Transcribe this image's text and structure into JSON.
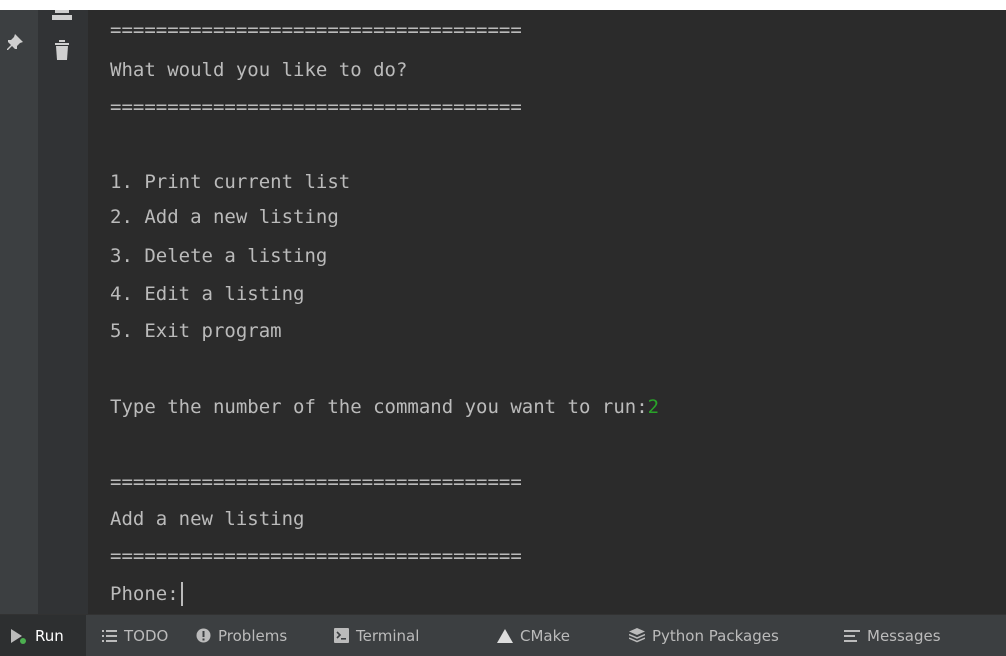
{
  "console": {
    "lines": [
      "====================================",
      "What would you like to do?",
      "====================================",
      "",
      "1. Print current list",
      "2. Add a new listing",
      "3. Delete a listing",
      "4. Edit a listing",
      "5. Exit program",
      "",
      "Type the number of the command you want to run:",
      "",
      "====================================",
      "Add a new listing",
      "===================================="
    ],
    "user_input": "2",
    "prompt": "Phone:"
  },
  "tool_window_bar": {
    "tabs": [
      {
        "label": "Run",
        "icon": "run-icon",
        "active": true
      },
      {
        "label": "TODO",
        "icon": "todo-list-icon"
      },
      {
        "label": "Problems",
        "icon": "problems-icon"
      },
      {
        "label": "Terminal",
        "icon": "terminal-icon"
      },
      {
        "label": "CMake",
        "icon": "cmake-icon"
      },
      {
        "label": "Python Packages",
        "icon": "python-packages-icon"
      },
      {
        "label": "Messages",
        "icon": "messages-icon"
      }
    ]
  },
  "colors": {
    "console_bg": "#2b2b2b",
    "console_text": "#bbbbbb",
    "user_input": "#29a329",
    "tool_bar_bg": "#3c3f41",
    "run_icon_green": "#4caf50"
  }
}
